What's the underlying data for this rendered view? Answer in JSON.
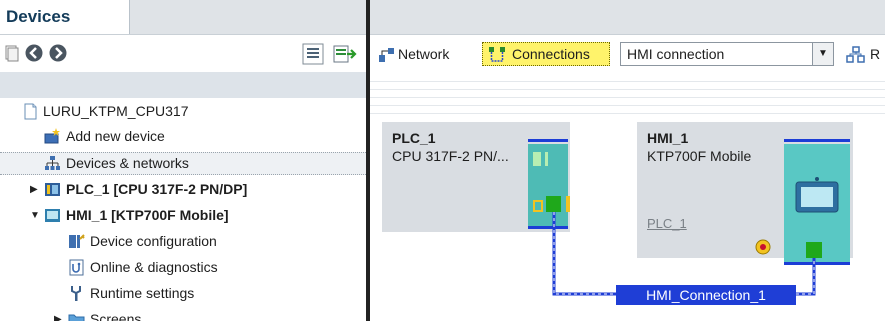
{
  "left_panel": {
    "tab_title": "Devices"
  },
  "tree": [
    {
      "label": "LURU_KTPM_CPU317",
      "icon": "project-icon",
      "bold": false
    },
    {
      "label": "Add new device",
      "icon": "add-device-icon",
      "bold": false
    },
    {
      "label": "Devices & networks",
      "icon": "network-icon",
      "bold": false,
      "selected": true
    },
    {
      "label": "PLC_1 [CPU 317F-2 PN/DP]",
      "icon": "plc-icon",
      "bold": true,
      "arrow": "collapsed"
    },
    {
      "label": "HMI_1 [KTP700F Mobile]",
      "icon": "hmi-icon",
      "bold": true,
      "arrow": "expanded"
    },
    {
      "label": "Device configuration",
      "icon": "device-config-icon",
      "bold": false
    },
    {
      "label": "Online & diagnostics",
      "icon": "online-diagnostics-icon",
      "bold": false
    },
    {
      "label": "Runtime settings",
      "icon": "runtime-settings-icon",
      "bold": false
    },
    {
      "label": "Screens",
      "icon": "folder-icon",
      "bold": false,
      "arrow": "collapsed"
    }
  ],
  "right_toolbar": {
    "network_label": "Network",
    "connections_label": "Connections",
    "connection_type": "HMI connection"
  },
  "devices": {
    "plc": {
      "name": "PLC_1",
      "type": "CPU 317F-2 PN/..."
    },
    "hmi": {
      "name": "HMI_1",
      "type": "KTP700F Mobile",
      "linked": "PLC_1"
    }
  },
  "connection": {
    "label": "HMI_Connection_1"
  },
  "colors": {
    "accent": "#1f3ed6",
    "highlight": "#fff36b",
    "module": "#4ebbb5",
    "port": "#1fa81b"
  }
}
